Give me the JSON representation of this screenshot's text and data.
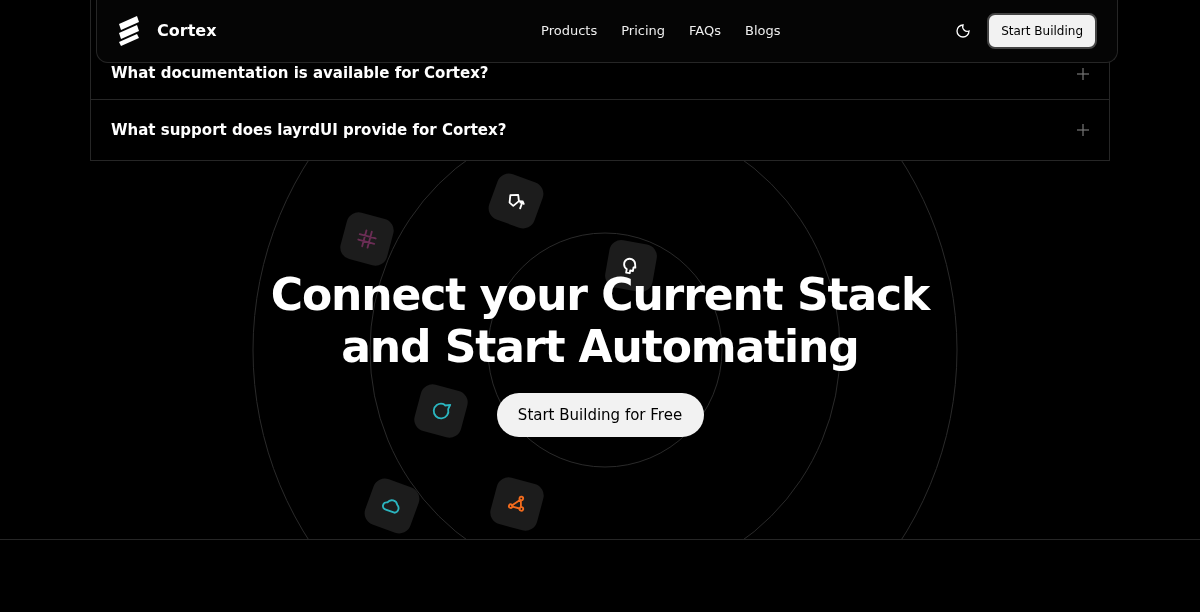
{
  "nav": {
    "brand": "Cortex",
    "links": [
      "Products",
      "Pricing",
      "FAQs",
      "Blogs"
    ],
    "cta": "Start Building"
  },
  "faq": [
    {
      "question": "What documentation is available for Cortex?",
      "expanded": false
    },
    {
      "question": "What support does layrdUI provide for Cortex?",
      "expanded": false
    }
  ],
  "hero": {
    "title_lines": [
      "Connect your Current Stack",
      "and Start Automating"
    ],
    "cta": "Start Building for Free",
    "tiles": [
      {
        "kind": "pen",
        "color": "#ffffff"
      },
      {
        "kind": "grid",
        "color": "#6b2d55"
      },
      {
        "kind": "head",
        "color": "#ffffff"
      },
      {
        "kind": "drop",
        "color": "#2bb5bf"
      },
      {
        "kind": "cloud",
        "color": "#2bb5bf"
      },
      {
        "kind": "nodes",
        "color": "#f26b1d"
      }
    ]
  }
}
